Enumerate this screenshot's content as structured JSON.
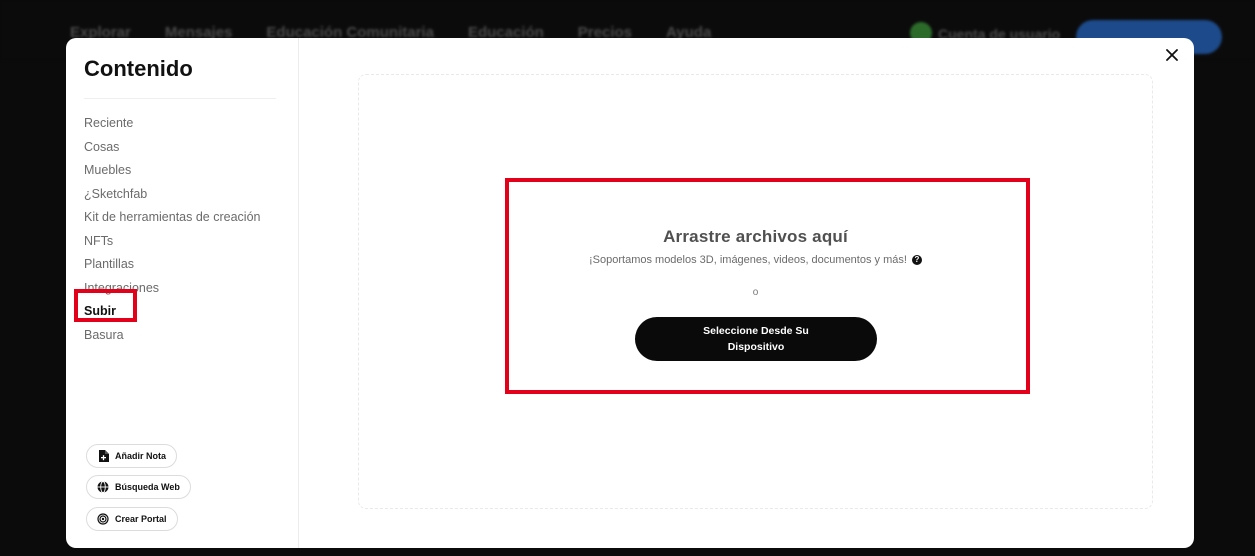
{
  "background": {
    "nav": [
      "Explorar",
      "Mensajes",
      "Educación Comunitaria",
      "Educación",
      "Precios",
      "Ayuda"
    ],
    "user_text": "Cuenta de usuario",
    "colors": {
      "accent_button": "#1c4a8a",
      "status_dot": "#2c6a2a"
    }
  },
  "modal": {
    "sidebar": {
      "title": "Contenido",
      "items": [
        {
          "label": "Reciente"
        },
        {
          "label": "Cosas"
        },
        {
          "label": "Muebles"
        },
        {
          "label": "¿Sketchfab"
        },
        {
          "label": "Kit de herramientas de creación"
        },
        {
          "label": "NFTs"
        },
        {
          "label": "Plantillas"
        },
        {
          "label": "Integraciones"
        },
        {
          "label": "Subir",
          "active": true
        },
        {
          "label": "Basura"
        }
      ],
      "buttons": [
        {
          "label": "Añadir Nota",
          "icon": "note-icon"
        },
        {
          "label": "Búsqueda Web",
          "icon": "globe-icon"
        },
        {
          "label": "Crear Portal",
          "icon": "portal-icon"
        }
      ]
    },
    "close_icon": "close-icon",
    "upload": {
      "title": "Arrastre archivos aquí",
      "subtitle": "¡Soportamos modelos 3D, imágenes, videos, documentos y más!",
      "help_icon": "?",
      "or": "o",
      "button_label": "Seleccione Desde Su Dispositivo"
    },
    "colors": {
      "highlight": "#e3001b",
      "button_bg": "#0a0a0a"
    }
  }
}
